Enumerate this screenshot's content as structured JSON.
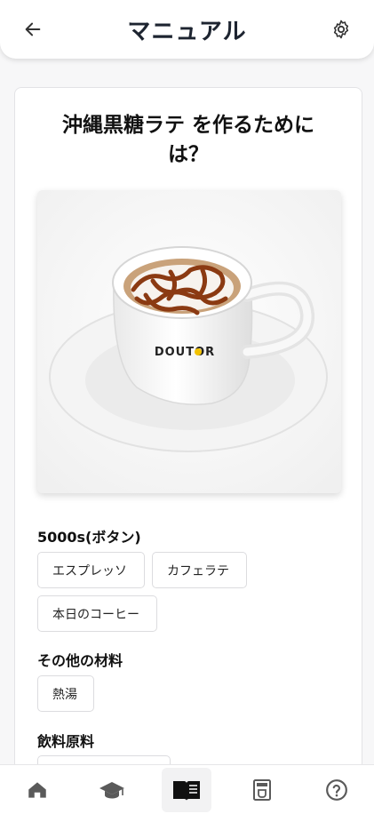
{
  "header": {
    "title": "マニュアル",
    "back_icon": "arrow-left-icon",
    "settings_icon": "gear-icon"
  },
  "card": {
    "title_line1": "沖縄黒糖ラテ を作るために",
    "title_line2": "は？",
    "photo_alt": "DOUTOR latte cup"
  },
  "sections": {
    "machine": {
      "label": "5000s(ボタン)",
      "chips": [
        "エスプレッソ",
        "カフェラテ",
        "本日のコーヒー"
      ]
    },
    "other": {
      "label": "その他の材料",
      "chips": [
        "熱湯"
      ]
    },
    "raw": {
      "label": "飲料原料"
    }
  },
  "nav": {
    "items": [
      {
        "name": "home",
        "icon": "home-icon"
      },
      {
        "name": "learn",
        "icon": "graduation-cap-icon"
      },
      {
        "name": "manual",
        "icon": "book-icon",
        "active": true
      },
      {
        "name": "machine",
        "icon": "coffee-machine-icon"
      },
      {
        "name": "help",
        "icon": "question-circle-icon"
      }
    ]
  },
  "colors": {
    "header_title": "#1d2430",
    "icon": "#555555",
    "active_nav_bg": "#f2f2f3"
  }
}
